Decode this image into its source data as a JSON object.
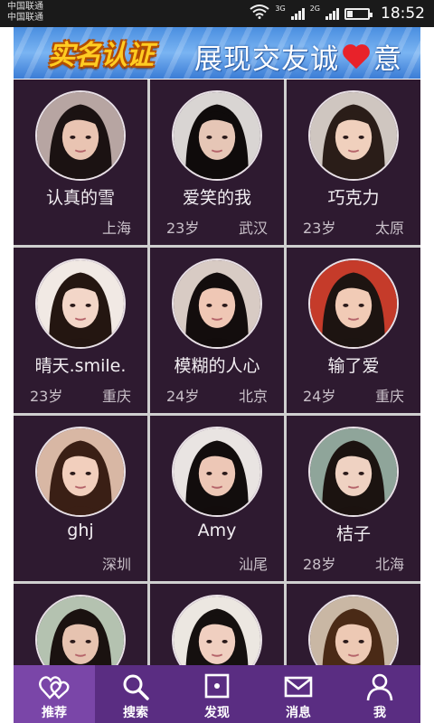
{
  "status_bar": {
    "carrier_1": "中国联通",
    "carrier_2": "中国联通",
    "network_1": "3G",
    "network_2": "2G",
    "time": "18:52",
    "battery_level": 0.25
  },
  "banner": {
    "badge": "实名认证",
    "slogan_before": "展现交友诚",
    "slogan_after": "意",
    "heart_icon": "heart-icon"
  },
  "profiles": [
    {
      "nickname": "认真的雪",
      "age": "",
      "city": "上海",
      "hair": "#1b1212",
      "skin": "#e9c4b2",
      "bg": "#b7a5a2"
    },
    {
      "nickname": "爱笑的我",
      "age": "23岁",
      "city": "武汉",
      "hair": "#0f0b0b",
      "skin": "#e6c6b6",
      "bg": "#d9d5d3"
    },
    {
      "nickname": "巧克力",
      "age": "23岁",
      "city": "太原",
      "hair": "#2a1d18",
      "skin": "#f0d0bd",
      "bg": "#cfc6c0"
    },
    {
      "nickname": "晴天.smile.",
      "age": "23岁",
      "city": "重庆",
      "hair": "#241611",
      "skin": "#f3d6c8",
      "bg": "#f1e9e4"
    },
    {
      "nickname": "模糊的人心",
      "age": "24岁",
      "city": "北京",
      "hair": "#130d0d",
      "skin": "#efc7b5",
      "bg": "#d8cbc4"
    },
    {
      "nickname": "输了爱",
      "age": "24岁",
      "city": "重庆",
      "hair": "#1d1411",
      "skin": "#f1cbb6",
      "bg": "#c53b2a"
    },
    {
      "nickname": "ghj",
      "age": "",
      "city": "深圳",
      "hair": "#3a1f15",
      "skin": "#f2cfbd",
      "bg": "#d8b7a4"
    },
    {
      "nickname": "Amy",
      "age": "",
      "city": "汕尾",
      "hair": "#120d0d",
      "skin": "#edc7b6",
      "bg": "#e9e4e2"
    },
    {
      "nickname": "桔子",
      "age": "28岁",
      "city": "北海",
      "hair": "#1b1310",
      "skin": "#efd2c2",
      "bg": "#8fa59a"
    },
    {
      "nickname": "",
      "age": "",
      "city": "",
      "hair": "#1a1210",
      "skin": "#e6c3b0",
      "bg": "#b4c2b0"
    },
    {
      "nickname": "",
      "age": "",
      "city": "",
      "hair": "#15100f",
      "skin": "#f0cfc0",
      "bg": "#ece7e1"
    },
    {
      "nickname": "",
      "age": "",
      "city": "",
      "hair": "#4a2a16",
      "skin": "#edc9b4",
      "bg": "#c9b7a4"
    }
  ],
  "tabs": [
    {
      "label": "推荐",
      "icon": "recommend-hearts-icon",
      "active": true
    },
    {
      "label": "搜索",
      "icon": "search-icon",
      "active": false
    },
    {
      "label": "发现",
      "icon": "discover-icon",
      "active": false
    },
    {
      "label": "消息",
      "icon": "envelope-icon",
      "active": false
    },
    {
      "label": "我",
      "icon": "person-icon",
      "active": false
    }
  ],
  "colors": {
    "card_bg": "#2e1a30",
    "tabbar_bg": "#5a2d82",
    "tab_active_bg": "#7a46a8"
  }
}
